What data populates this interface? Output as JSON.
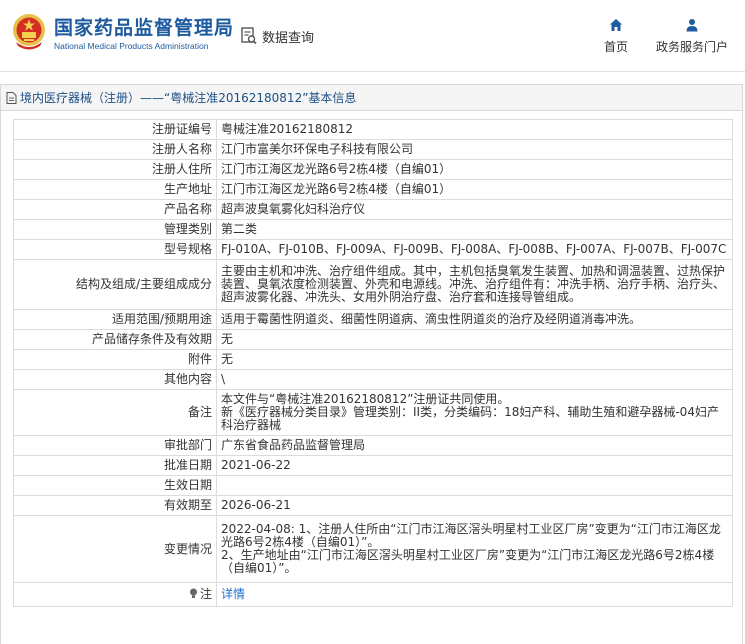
{
  "header": {
    "brand_cn": "国家药品监督管理局",
    "brand_en": "National Medical Products Administration",
    "db_query_label": "数据查询",
    "nav": [
      {
        "label": "首页",
        "icon": "home-icon"
      },
      {
        "label": "政务服务门户",
        "icon": "user-icon"
      }
    ],
    "brand_color": "#1d5a9e"
  },
  "panel": {
    "title": "境内医疗器械（注册）——“粤械注准20162180812”基本信息"
  },
  "rows": [
    {
      "key": "注册证编号",
      "value": "粤械注准20162180812"
    },
    {
      "key": "注册人名称",
      "value": "江门市富美尔环保电子科技有限公司"
    },
    {
      "key": "注册人住所",
      "value": "江门市江海区龙光路6号2栋4楼（自编01）"
    },
    {
      "key": "生产地址",
      "value": "江门市江海区龙光路6号2栋4楼（自编01）"
    },
    {
      "key": "产品名称",
      "value": "超声波臭氧雾化妇科治疗仪"
    },
    {
      "key": "管理类别",
      "value": "第二类"
    },
    {
      "key": "型号规格",
      "value": "FJ-010A、FJ-010B、FJ-009A、FJ-009B、FJ-008A、FJ-008B、FJ-007A、FJ-007B、FJ-007C"
    },
    {
      "key": "结构及组成/主要组成成分",
      "value": "主要由主机和冲洗、治疗组件组成。其中，主机包括臭氧发生装置、加热和调温装置、过热保护装置、臭氧浓度检测装置、外壳和电源线。冲洗、治疗组件有：冲洗手柄、治疗手柄、治疗头、超声波雾化器、冲洗头、女用外阴治疗盘、治疗套和连接导管组成。"
    },
    {
      "key": "适用范围/预期用途",
      "value": "适用于霉菌性阴道炎、细菌性阴道病、滴虫性阴道炎的治疗及经阴道消毒冲洗。"
    },
    {
      "key": "产品储存条件及有效期",
      "value": "无"
    },
    {
      "key": "附件",
      "value": "无"
    },
    {
      "key": "其他内容",
      "value": "\\"
    },
    {
      "key": "备注",
      "value": "本文件与“粤械注准20162180812”注册证共同使用。\n新《医疗器械分类目录》管理类别：II类，分类编码：18妇产科、辅助生殖和避孕器械-04妇产科治疗器械"
    },
    {
      "key": "审批部门",
      "value": "广东省食品药品监督管理局"
    },
    {
      "key": "批准日期",
      "value": "2021-06-22"
    },
    {
      "key": "生效日期",
      "value": ""
    },
    {
      "key": "有效期至",
      "value": "2026-06-21"
    },
    {
      "key": "变更情况",
      "value": "2022-04-08: 1、注册人住所由“江门市江海区滘头明星村工业区厂房”变更为“江门市江海区龙光路6号2栋4楼（自编01）”。\n2、生产地址由“江门市江海区滘头明星村工业区厂房”变更为“江门市江海区龙光路6号2栋4楼（自编01）”。"
    }
  ],
  "note": {
    "key": "注",
    "link": "详情",
    "icon": "lightbulb-icon"
  }
}
